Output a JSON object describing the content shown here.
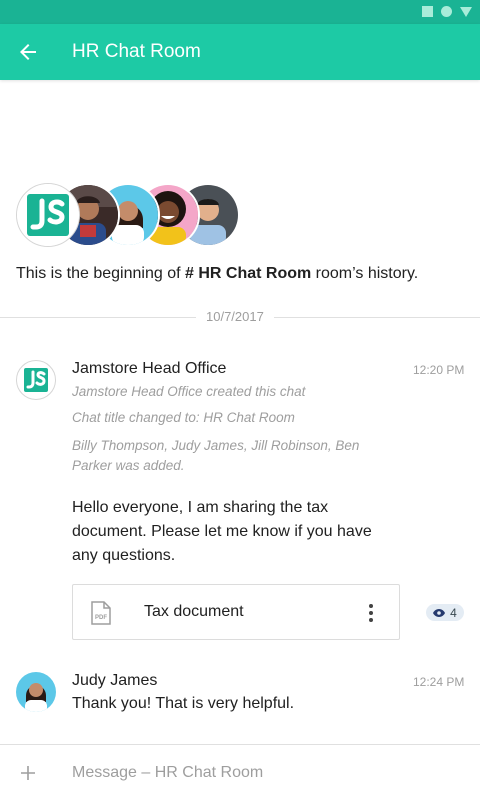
{
  "app_bar": {
    "title": "HR Chat Room"
  },
  "history": {
    "prefix": "This is the beginning of ",
    "room": "# HR Chat Room",
    "suffix": " room’s history."
  },
  "date_divider": "10/7/2017",
  "messages": [
    {
      "sender": "Jamstore Head Office",
      "time": "12:20 PM",
      "system_lines": [
        "Jamstore Head Office created this chat",
        "Chat title changed to: HR Chat Room",
        "Billy Thompson, Judy James, Jill Robinson, Ben",
        "Parker was added."
      ],
      "text_lines": [
        "Hello everyone, I am sharing the tax",
        "document. Please let me know if you have",
        "any questions."
      ],
      "attachment": {
        "type_label": "PDF",
        "name": "Tax document"
      },
      "seen_count": "4"
    },
    {
      "sender": "Judy James",
      "time": "12:24 PM",
      "text": "Thank you! That is very helpful."
    }
  ],
  "composer": {
    "placeholder": "Message – HR Chat Room"
  },
  "colors": {
    "status_bar": "#1ab394",
    "app_bar": "#1dcaa5",
    "brand_logo": "#1ab394"
  },
  "icons": [
    "back-arrow-icon",
    "pdf-file-icon",
    "more-vert-icon",
    "eye-icon",
    "plus-icon"
  ]
}
